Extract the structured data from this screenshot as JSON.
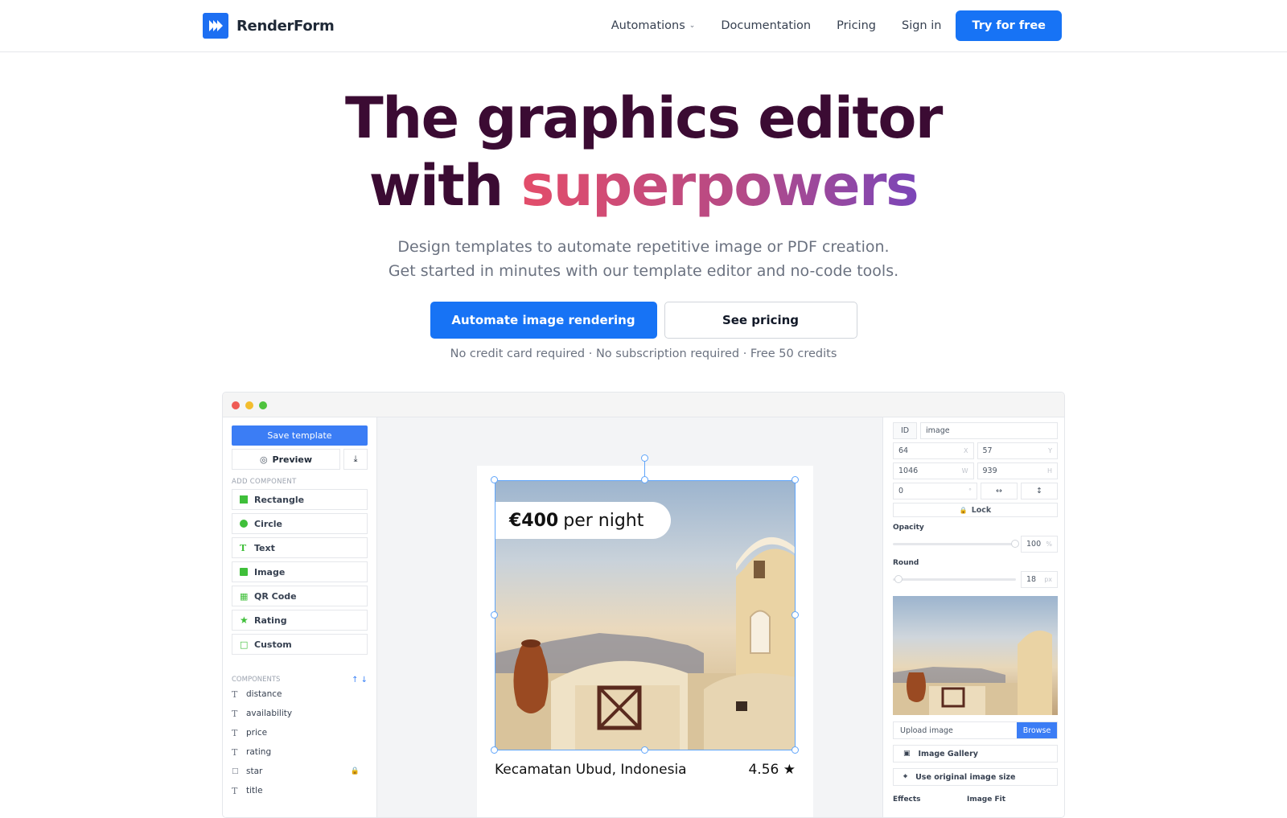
{
  "brand": {
    "name": "RenderForm",
    "accent": "#1773f5"
  },
  "nav": {
    "items": [
      "Automations",
      "Documentation",
      "Pricing",
      "Sign in"
    ],
    "cta": "Try for free"
  },
  "hero": {
    "title_line1": "The graphics editor",
    "title_line2_plain": "with ",
    "title_line2_accent": "superpowers",
    "subtitle_line1": "Design templates to automate repetitive image or PDF creation.",
    "subtitle_line2": "Get started in minutes with our template editor and no-code tools.",
    "primary_cta": "Automate image rendering",
    "secondary_cta": "See pricing",
    "fine_print": "No credit card required · No subscription required · Free 50 credits"
  },
  "editor": {
    "left": {
      "save": "Save template",
      "preview": "Preview",
      "add_component_label": "ADD COMPONENT",
      "add_components": [
        "Rectangle",
        "Circle",
        "Text",
        "Image",
        "QR Code",
        "Rating",
        "Custom"
      ],
      "components_label": "COMPONENTS",
      "components": [
        "distance",
        "availability",
        "price",
        "rating",
        "star",
        "title"
      ]
    },
    "canvas": {
      "price_amount": "€400",
      "price_suffix": "per night",
      "location": "Kecamatan Ubud, Indonesia",
      "rating": "4.56"
    },
    "right": {
      "id_label": "ID",
      "id_value": "image",
      "x": "64",
      "x_unit": "X",
      "y": "57",
      "y_unit": "Y",
      "w": "1046",
      "w_unit": "W",
      "h": "939",
      "h_unit": "H",
      "rotation": "0",
      "rotation_unit": "°",
      "lock": "Lock",
      "opacity_label": "Opacity",
      "opacity_value": "100",
      "opacity_unit": "%",
      "round_label": "Round",
      "round_value": "18",
      "round_unit": "px",
      "upload_placeholder": "Upload image",
      "browse": "Browse",
      "gallery": "Image Gallery",
      "original_size": "Use original image size",
      "effects_label": "Effects",
      "fit_label": "Image Fit"
    }
  }
}
